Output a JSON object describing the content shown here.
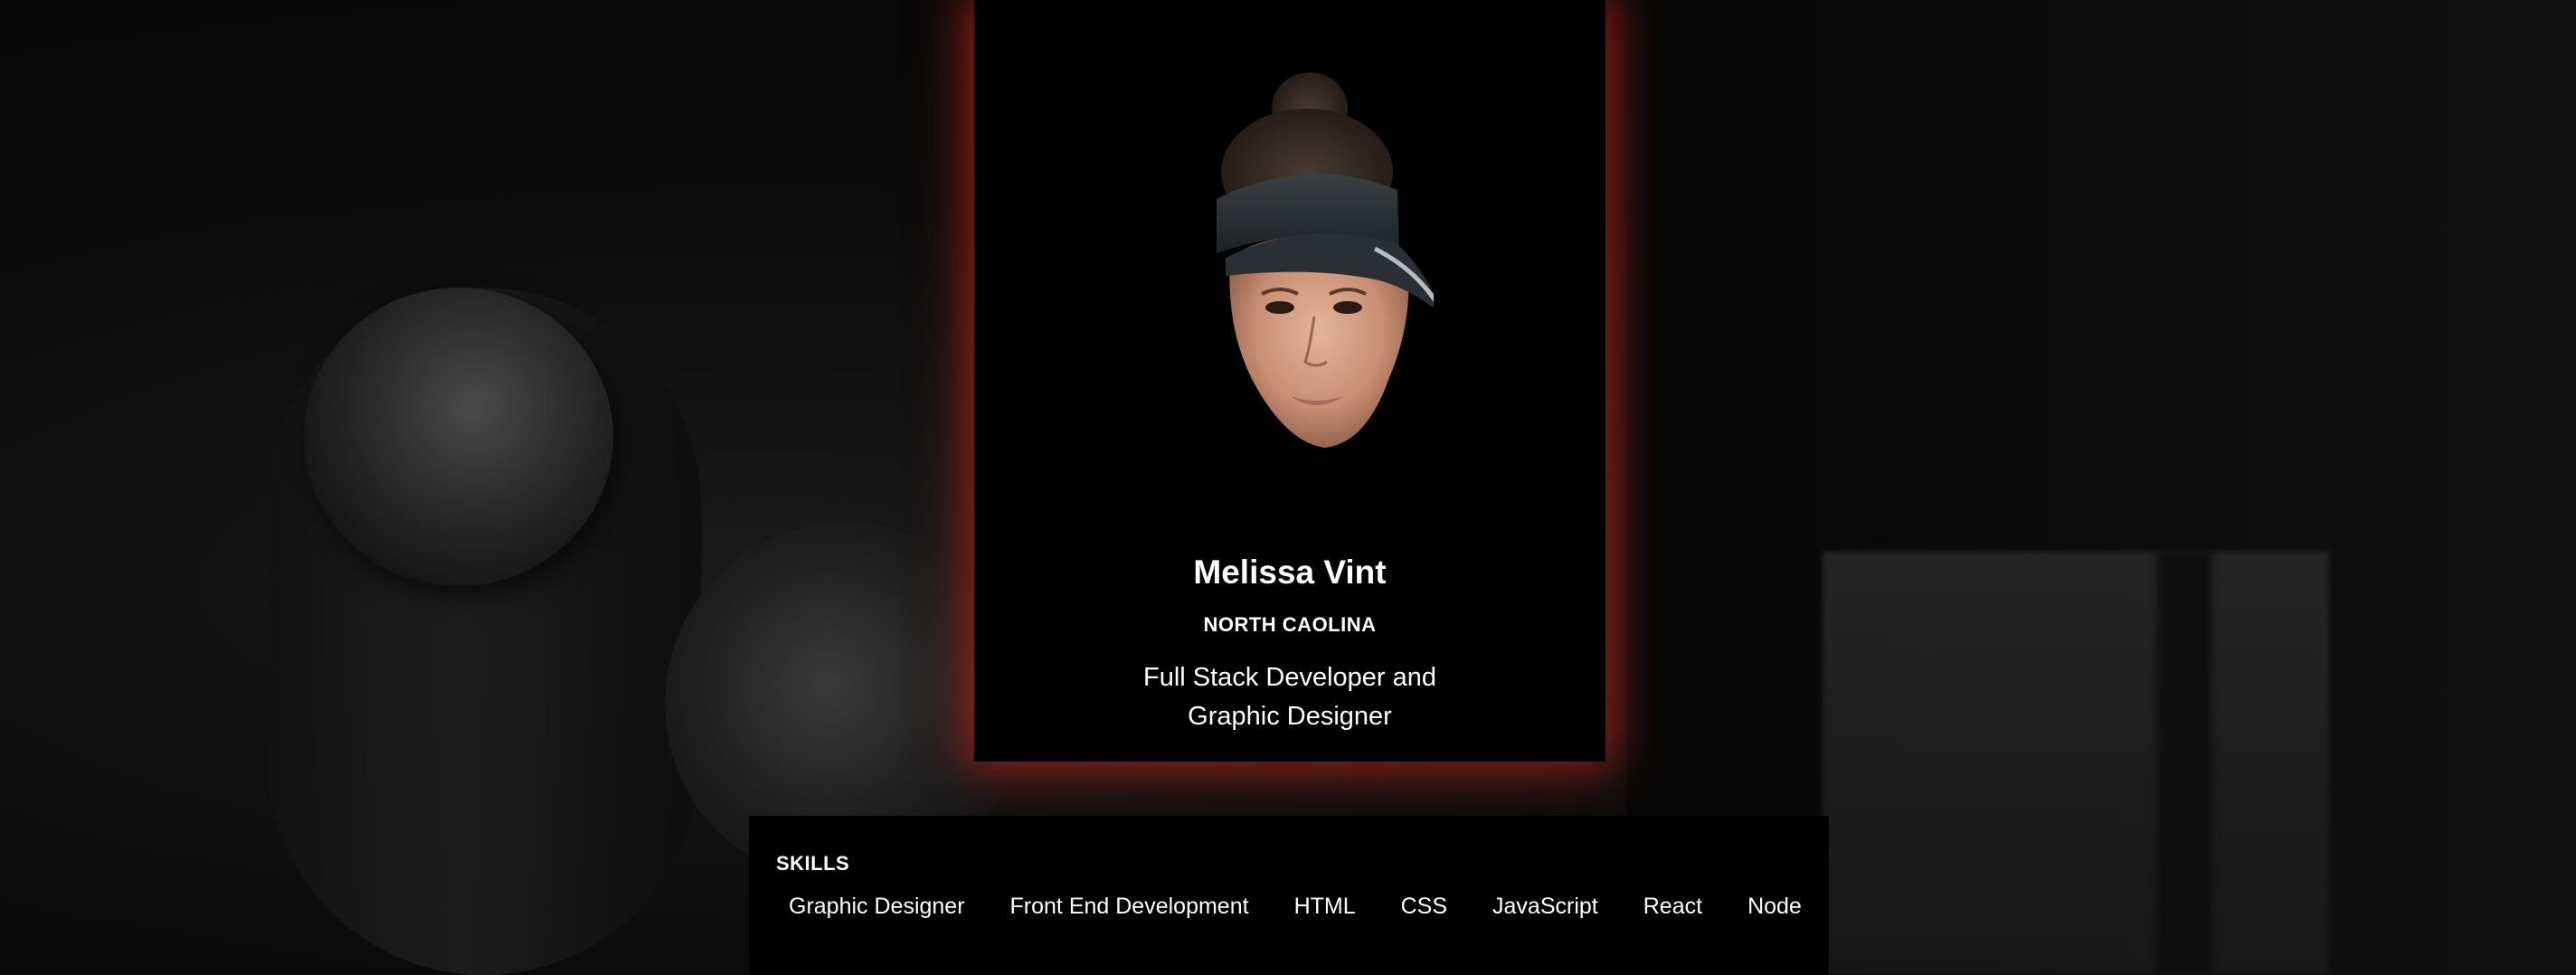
{
  "profile": {
    "name": "Melissa Vint",
    "location": "NORTH CAOLINA",
    "tagline": "Full Stack Developer and Graphic Designer"
  },
  "skills": {
    "title": "SKILLS",
    "items": [
      "Graphic Designer",
      "Front End Development",
      "HTML",
      "CSS",
      "JavaScript",
      "React",
      "Node"
    ]
  },
  "colors": {
    "accent_glow": "#c8281e",
    "card": "#000000",
    "text": "#ffffff"
  }
}
